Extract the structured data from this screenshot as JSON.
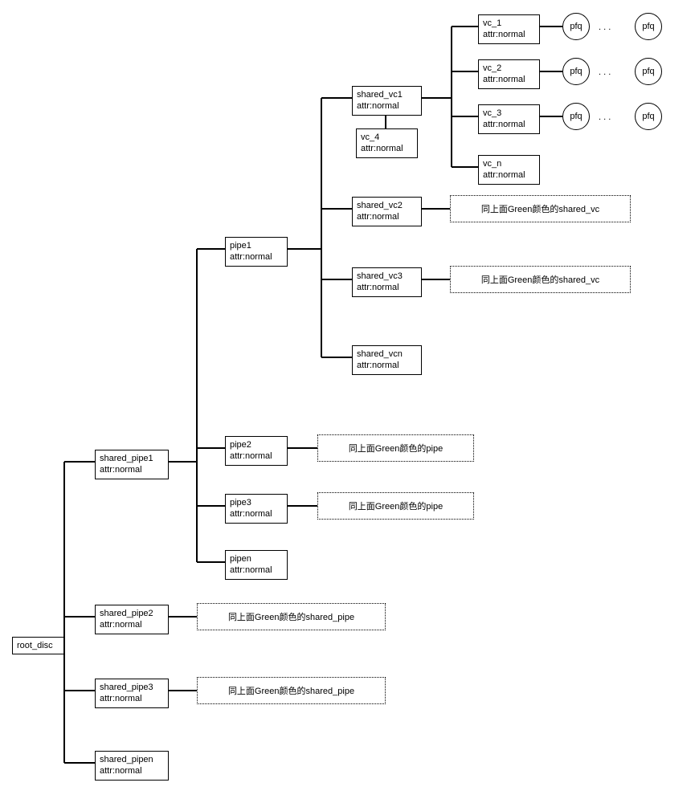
{
  "root": {
    "name": "root_disc"
  },
  "shared_pipes": [
    {
      "name": "shared_pipe1",
      "attr": "attr:normal"
    },
    {
      "name": "shared_pipe2",
      "attr": "attr:normal"
    },
    {
      "name": "shared_pipe3",
      "attr": "attr:normal"
    },
    {
      "name": "shared_pipen",
      "attr": "attr:normal"
    }
  ],
  "pipes": [
    {
      "name": "pipe1",
      "attr": "attr:normal"
    },
    {
      "name": "pipe2",
      "attr": "attr:normal"
    },
    {
      "name": "pipe3",
      "attr": "attr:normal"
    },
    {
      "name": "pipen",
      "attr": "attr:normal"
    }
  ],
  "shared_vcs": [
    {
      "name": "shared_vc1",
      "attr": "attr:normal"
    },
    {
      "name": "shared_vc2",
      "attr": "attr:normal"
    },
    {
      "name": "shared_vc3",
      "attr": "attr:normal"
    },
    {
      "name": "shared_vcn",
      "attr": "attr:normal"
    }
  ],
  "vcs": [
    {
      "name": "vc_1",
      "attr": "attr:normal"
    },
    {
      "name": "vc_2",
      "attr": "attr:normal"
    },
    {
      "name": "vc_3",
      "attr": "attr:normal"
    },
    {
      "name": "vc_4",
      "attr": "attr:normal"
    },
    {
      "name": "vc_n",
      "attr": "attr:normal"
    }
  ],
  "pfq_label": "pfq",
  "notes": {
    "shared_vc": "同上面Green颜色的shared_vc",
    "pipe": "同上面Green颜色的pipe",
    "shared_pipe": "同上面Green颜色的shared_pipe"
  },
  "ellipsis": ". . ."
}
